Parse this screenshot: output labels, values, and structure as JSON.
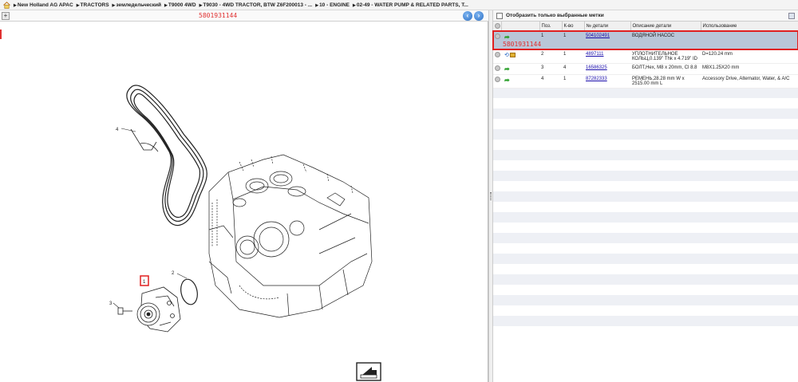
{
  "breadcrumb": [
    "New Holland AG APAC",
    "TRACTORS",
    "земледельческий",
    "T9000 4WD",
    "T9030 - 4WD TRACTOR, BTW Z6F200013 - ...",
    "10 - ENGINE",
    "02-49 - WATER PUMP & RELATED PARTS, T..."
  ],
  "left": {
    "part_number_header": "5801931144",
    "callouts": [
      "4",
      "2",
      "3",
      "1"
    ]
  },
  "right": {
    "filter_label": "Отобразить только выбранные метки",
    "columns": [
      "Поз.",
      "К-во",
      "№ детали",
      "Описание детали",
      "Использование"
    ],
    "rows": [
      {
        "marker": "5801931144",
        "pos": "1",
        "qty": "1",
        "part": "504102491",
        "desc": "ВОДЯНОЙ НАСОС",
        "usage": "",
        "selected": true
      },
      {
        "marker": "",
        "pos": "2",
        "qty": "1",
        "part": "4897111",
        "desc": "УПЛОТНИТЕЛЬНОЕ КОЛЬЦ,0.139\" Thk x 4.719\" ID",
        "usage": "D=120.24 mm",
        "selected": false
      },
      {
        "marker": "",
        "pos": "3",
        "qty": "4",
        "part": "16586325",
        "desc": "БОЛТ,Hex, M8 x 20mm, Cl 8.8",
        "usage": "M8X1.25X20 mm",
        "selected": false
      },
      {
        "marker": "",
        "pos": "4",
        "qty": "1",
        "part": "87282333",
        "desc": "РЕМЕНЬ,28.28 mm W x 2515.00 mm L",
        "usage": "Accessory Drive, Alternator, Water, & A/C",
        "selected": false
      }
    ]
  }
}
